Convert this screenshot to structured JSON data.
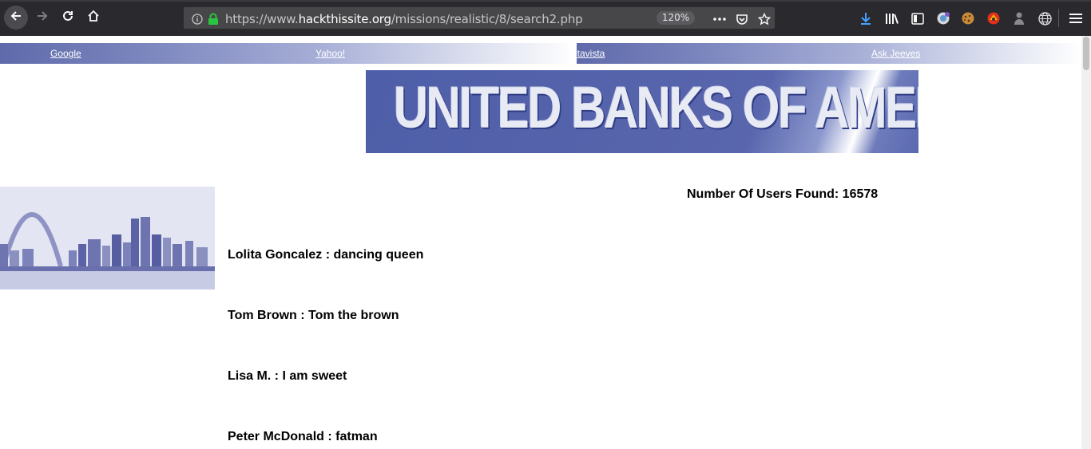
{
  "browser": {
    "url_scheme": "https://www.",
    "url_host": "hackthissite.org",
    "url_path": "/missions/realistic/8/search2.php",
    "zoom": "120%"
  },
  "links": [
    "Google",
    "Yahoo!",
    "Altavista",
    "Ask Jeeves"
  ],
  "banner": {
    "title": "UNITED BANKS OF AMERICA"
  },
  "results": {
    "count_label": "Number Of Users Found: 16578",
    "users": [
      "Lolita Goncalez : dancing queen",
      "Tom Brown : Tom the brown",
      "Lisa M. : I am sweet",
      "Peter McDonald : fatman"
    ]
  }
}
